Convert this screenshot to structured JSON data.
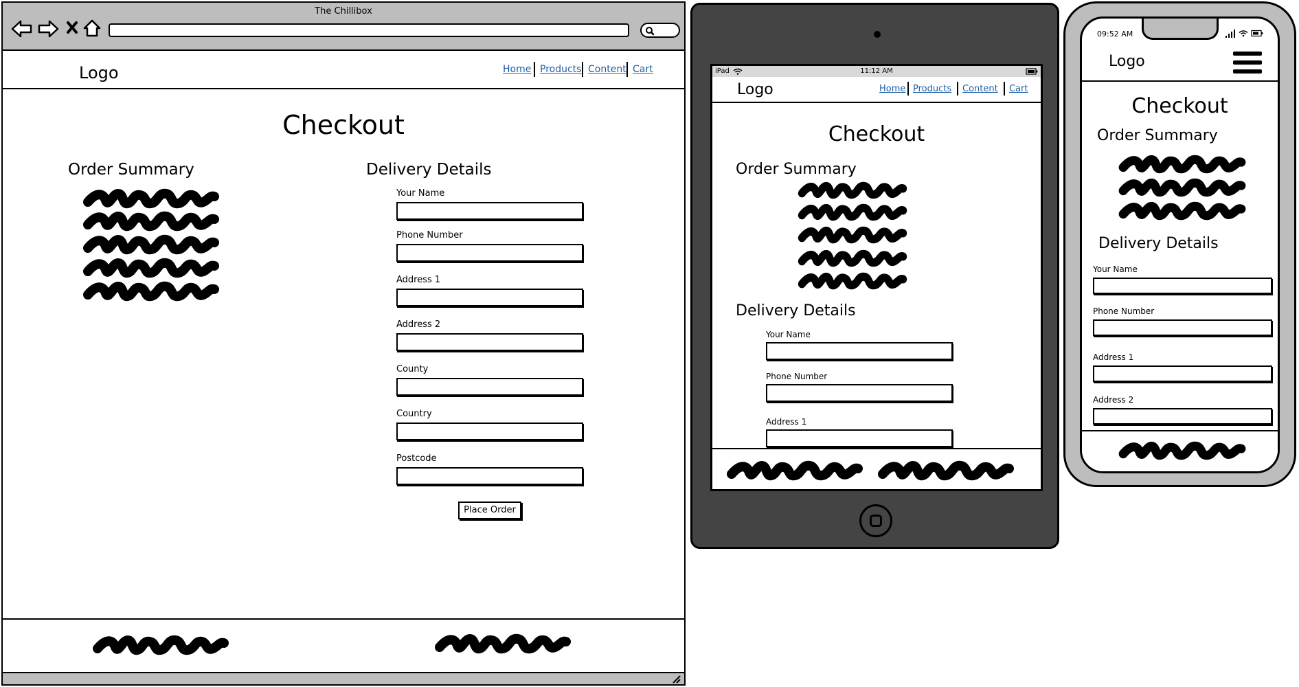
{
  "browser": {
    "title": "The Chillibox"
  },
  "site": {
    "logo": "Logo",
    "nav": [
      "Home",
      "Products",
      "Content",
      "Cart"
    ],
    "page_title": "Checkout",
    "order_summary_heading": "Order Summary",
    "delivery_heading": "Delivery Details",
    "fields": [
      "Your Name",
      "Phone Number",
      "Address 1",
      "Address 2",
      "County",
      "Country",
      "Postcode"
    ],
    "submit_label": "Place Order"
  },
  "tablet": {
    "status_left": "iPad",
    "time": "11:12 AM"
  },
  "phone": {
    "time": "09:52 AM"
  },
  "colors": {
    "frame_gray": "#bdbdbd",
    "tablet_body": "#444444",
    "link_blue": "#1f5fa8"
  },
  "icons": [
    "back-arrow-icon",
    "forward-arrow-icon",
    "close-x-icon",
    "home-icon",
    "search-icon",
    "resize-grip-icon",
    "wifi-icon",
    "battery-icon",
    "signal-icon",
    "hamburger-menu-icon",
    "home-button-icon",
    "camera-icon"
  ]
}
